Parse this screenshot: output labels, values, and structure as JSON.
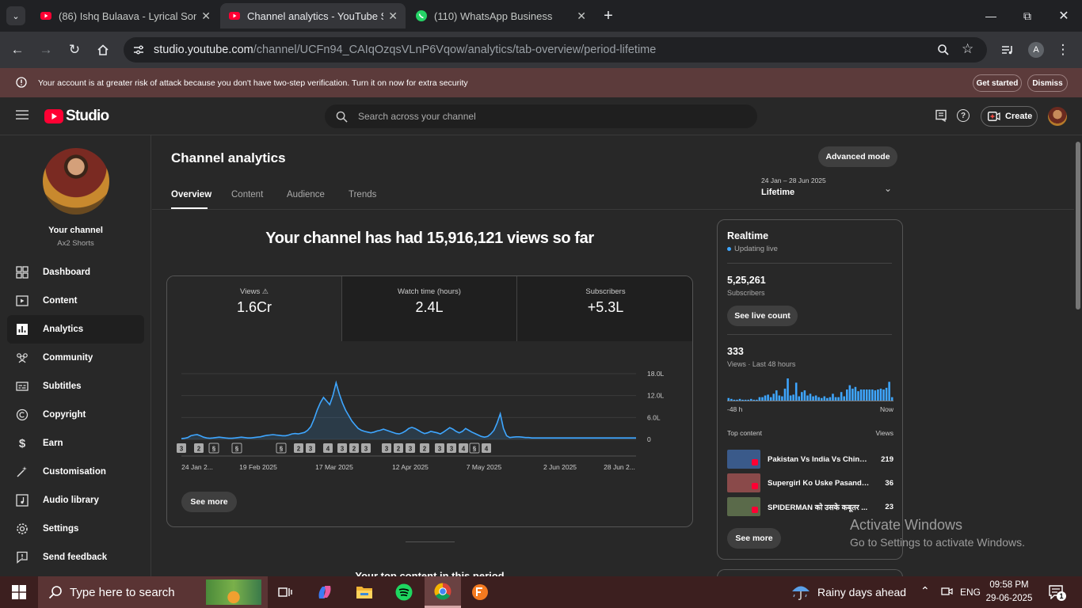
{
  "browser": {
    "tabs": [
      {
        "title": "(86) Ishq Bulaava - Lyrical Song",
        "icon": "youtube-icon"
      },
      {
        "title": "Channel analytics - YouTube Studio",
        "icon": "youtube-icon",
        "active": true
      },
      {
        "title": "(110) WhatsApp Business",
        "icon": "whatsapp-icon"
      }
    ],
    "url_host": "studio.youtube.com",
    "url_path": "/channel/UCFn94_CAIqOzqsVLnP6Vqow/analytics/tab-overview/period-lifetime",
    "profile_initial": "A"
  },
  "banner": {
    "text": "Your account is at greater risk of attack because you don't have two-step verification. Turn it on now for extra security",
    "get_started": "Get started",
    "dismiss": "Dismiss"
  },
  "header": {
    "logo_text": "Studio",
    "search_placeholder": "Search across your channel",
    "create_label": "Create"
  },
  "sidebar": {
    "channel_title": "Your channel",
    "channel_name": "Ax2 Shorts",
    "items": [
      {
        "label": "Dashboard",
        "icon": "dashboard-icon"
      },
      {
        "label": "Content",
        "icon": "content-icon"
      },
      {
        "label": "Analytics",
        "icon": "analytics-icon",
        "active": true
      },
      {
        "label": "Community",
        "icon": "community-icon"
      },
      {
        "label": "Subtitles",
        "icon": "subtitles-icon"
      },
      {
        "label": "Copyright",
        "icon": "copyright-icon"
      },
      {
        "label": "Earn",
        "icon": "earn-icon"
      },
      {
        "label": "Customisation",
        "icon": "customisation-icon"
      },
      {
        "label": "Audio library",
        "icon": "audio-library-icon"
      },
      {
        "label": "Settings",
        "icon": "settings-icon"
      },
      {
        "label": "Send feedback",
        "icon": "feedback-icon"
      }
    ]
  },
  "main": {
    "title": "Channel analytics",
    "advanced_mode": "Advanced mode",
    "tabs": [
      "Overview",
      "Content",
      "Audience",
      "Trends"
    ],
    "period_range": "24 Jan – 28 Jun 2025",
    "period_label": "Lifetime",
    "headline": "Your channel has had 15,916,121 views so far",
    "metrics": [
      {
        "label": "Views",
        "value": "1.6Cr"
      },
      {
        "label": "Watch time (hours)",
        "value": "2.4L"
      },
      {
        "label": "Subscribers",
        "value": "+5.3L"
      }
    ],
    "see_more": "See more",
    "next_section": "Your top content in this period"
  },
  "chart_data": {
    "type": "line",
    "series_metric": "Views",
    "x_ticks": [
      "24 Jan 2...",
      "19 Feb 2025",
      "17 Mar 2025",
      "12 Apr 2025",
      "7 May 2025",
      "2 Jun 2025",
      "28 Jun 2..."
    ],
    "y_ticks": [
      "0",
      "6.0L",
      "12.0L",
      "18.0L"
    ],
    "ylim": [
      0,
      1800000
    ],
    "grid": true,
    "values_in_lakh": [
      0.2,
      0.3,
      0.5,
      1.0,
      1.2,
      1.3,
      1.0,
      0.6,
      0.4,
      0.3,
      0.4,
      0.5,
      0.6,
      0.5,
      0.4,
      0.3,
      0.3,
      0.4,
      0.5,
      0.6,
      0.5,
      0.4,
      0.4,
      0.5,
      0.6,
      0.7,
      0.9,
      1.1,
      1.2,
      1.3,
      1.2,
      1.1,
      1.0,
      1.0,
      1.2,
      1.5,
      1.6,
      1.5,
      1.7,
      1.9,
      2.5,
      3.5,
      5.5,
      8.0,
      10.0,
      11.5,
      10.5,
      9.5,
      12.0,
      15.5,
      12.5,
      10.0,
      8.0,
      6.5,
      5.0,
      4.0,
      3.0,
      2.5,
      2.2,
      2.0,
      1.8,
      2.0,
      2.3,
      2.5,
      2.8,
      2.5,
      2.2,
      1.9,
      1.6,
      1.5,
      1.8,
      2.3,
      3.0,
      3.3,
      3.0,
      2.5,
      2.0,
      1.6,
      1.8,
      2.2,
      2.0,
      1.8,
      1.5,
      2.0,
      2.6,
      3.2,
      2.8,
      2.2,
      1.8,
      2.2,
      3.0,
      2.5,
      2.0,
      1.6,
      1.2,
      0.8,
      0.6,
      0.8,
      1.5,
      2.5,
      4.5,
      7.0,
      3.0,
      1.0,
      0.5,
      0.6,
      0.7,
      0.7,
      0.6,
      0.5,
      0.5,
      0.4,
      0.4,
      0.4,
      0.4,
      0.4,
      0.4,
      0.4,
      0.4,
      0.4,
      0.4,
      0.4,
      0.4,
      0.4,
      0.4,
      0.4,
      0.4,
      0.4,
      0.4,
      0.4,
      0.4,
      0.4,
      0.4,
      0.4,
      0.4,
      0.4,
      0.4,
      0.4,
      0.4,
      0.4,
      0.4,
      0.4,
      0.4,
      0.4,
      0.4
    ],
    "markers": [
      "3",
      "2",
      "s",
      "s",
      "s",
      "2",
      "3",
      "4",
      "3",
      "2",
      "3",
      "3",
      "2",
      "3",
      "2",
      "3",
      "3",
      "4",
      "s",
      "4"
    ]
  },
  "realtime": {
    "title": "Realtime",
    "status": "Updating live",
    "subs_value": "5,25,261",
    "subs_label": "Subscribers",
    "live_count": "See live count",
    "views_value": "333",
    "views_label": "Views · Last 48 hours",
    "bar_left": "-48 h",
    "bar_right": "Now",
    "bars": [
      3,
      2,
      1,
      1,
      2,
      1,
      1,
      1,
      2,
      1,
      1,
      4,
      4,
      6,
      7,
      4,
      8,
      12,
      6,
      5,
      14,
      26,
      6,
      7,
      21,
      5,
      10,
      12,
      6,
      8,
      5,
      6,
      4,
      3,
      5,
      3,
      4,
      8,
      4,
      4,
      10,
      5,
      13,
      18,
      14,
      16,
      11,
      13,
      13,
      13,
      13,
      13,
      12,
      13,
      14,
      13,
      15,
      22,
      4
    ],
    "top_content_label": "Top content",
    "top_content_col": "Views",
    "items": [
      {
        "title": "Pakistan Vs India Vs China...",
        "views": "219",
        "thumb": "#3a5a8a"
      },
      {
        "title": "Supergirl Ko Uske Pasand K...",
        "views": "36",
        "thumb": "#8a4a4a"
      },
      {
        "title": "SPIDERMAN को उसके कबूतर ...",
        "views": "23",
        "thumb": "#5a6a4a"
      }
    ],
    "see_more": "See more"
  },
  "watermark": {
    "line1": "Activate Windows",
    "line2": "Go to Settings to activate Windows."
  },
  "taskbar": {
    "search_placeholder": "Type here to search",
    "weather": "Rainy days ahead",
    "lang": "ENG",
    "time": "09:58 PM",
    "date": "29-06-2025",
    "notifications": "1"
  },
  "colors": {
    "accent": "#3ea6ff",
    "youtube_red": "#ff0033",
    "banner_bg": "#5c3b3b"
  }
}
